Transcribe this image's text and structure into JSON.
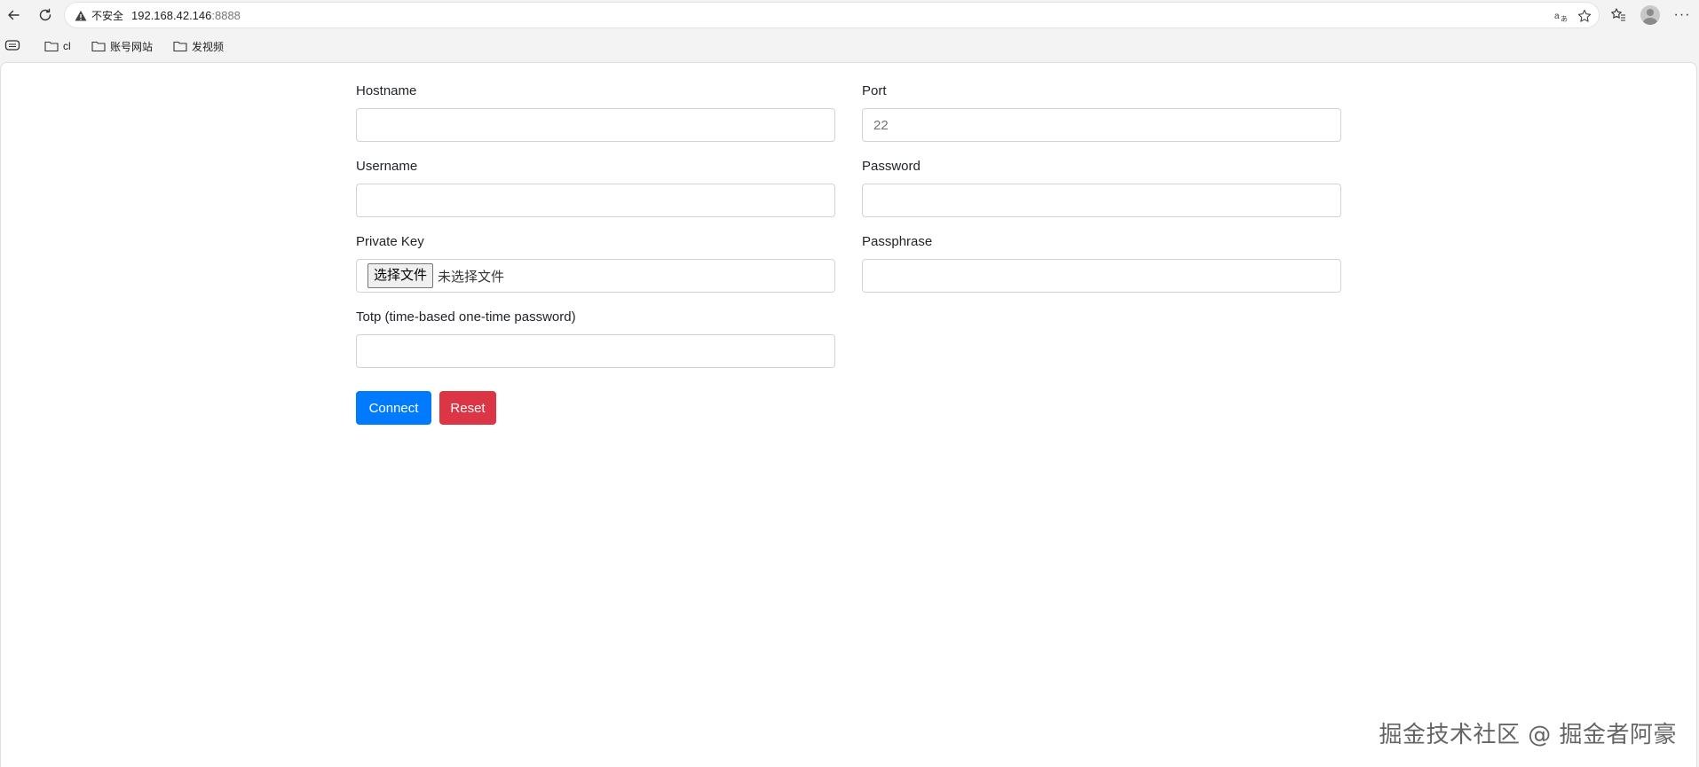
{
  "browser": {
    "security_label": "不安全",
    "url_host": "192.168.42.146",
    "url_port": ":8888",
    "icons": [
      "back-icon",
      "refresh-icon",
      "warning-icon",
      "read-aloud-icon",
      "favorite-star-icon",
      "favorites-icon",
      "profile-icon",
      "more-icon"
    ]
  },
  "bookmarks": {
    "items": [
      {
        "label": "cl",
        "icon": "folder-icon"
      },
      {
        "label": "账号网站",
        "icon": "folder-icon"
      },
      {
        "label": "发视频",
        "icon": "folder-icon"
      }
    ]
  },
  "form": {
    "hostname": {
      "label": "Hostname",
      "value": "",
      "placeholder": ""
    },
    "port": {
      "label": "Port",
      "value": "",
      "placeholder": "22"
    },
    "username": {
      "label": "Username",
      "value": "",
      "placeholder": ""
    },
    "password": {
      "label": "Password",
      "value": "",
      "placeholder": ""
    },
    "private_key": {
      "label": "Private Key",
      "button_label": "选择文件",
      "status": "未选择文件"
    },
    "passphrase": {
      "label": "Passphrase",
      "value": "",
      "placeholder": ""
    },
    "totp": {
      "label": "Totp (time-based one-time password)",
      "value": "",
      "placeholder": ""
    },
    "connect_label": "Connect",
    "reset_label": "Reset"
  },
  "colors": {
    "primary": "#007bff",
    "danger": "#dc3545",
    "input_border": "#ced4da"
  },
  "watermark": "掘金技术社区 @ 掘金者阿豪"
}
